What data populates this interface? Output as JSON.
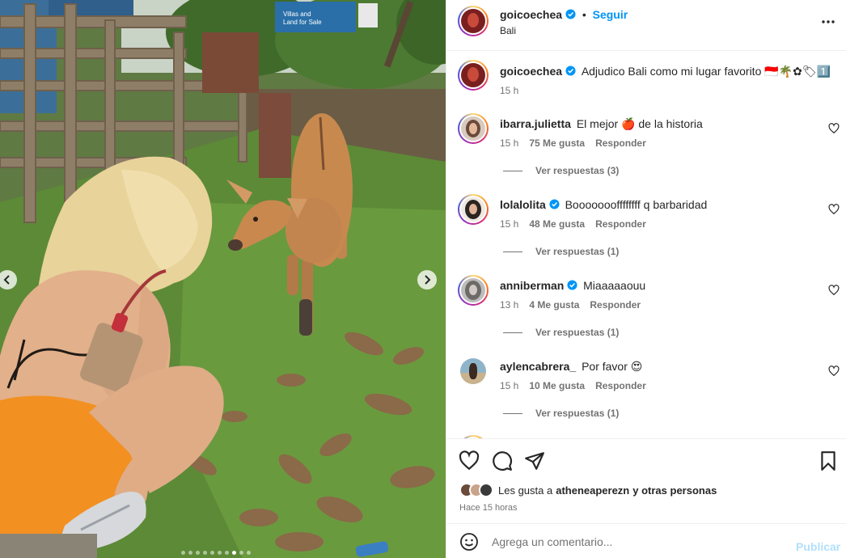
{
  "post": {
    "author": "goicoechea",
    "follow_label": "Seguir",
    "separator": "•",
    "location": "Bali",
    "caption": "Adjudico Bali como mi lugar favorito 🇮🇩🌴✿🏷1️⃣",
    "caption_time": "15 h"
  },
  "comments": [
    {
      "user": "ibarra.julietta",
      "verified": false,
      "text": "El mejor 🍎 de la historia",
      "time": "15 h",
      "likes": "75 Me gusta",
      "reply": "Responder",
      "view_replies": "Ver respuestas (3)"
    },
    {
      "user": "lolalolita",
      "verified": true,
      "text": "Boooooooffffffff q barbaridad",
      "time": "15 h",
      "likes": "48 Me gusta",
      "reply": "Responder",
      "view_replies": "Ver respuestas (1)"
    },
    {
      "user": "anniberman",
      "verified": true,
      "text": "Miaaaaaouu",
      "time": "13 h",
      "likes": "4 Me gusta",
      "reply": "Responder",
      "view_replies": "Ver respuestas (1)"
    },
    {
      "user": "aylencabrera_",
      "verified": false,
      "text": "Por favor 😍",
      "time": "15 h",
      "likes": "10 Me gusta",
      "reply": "Responder",
      "view_replies": "Ver respuestas (1)"
    }
  ],
  "likes": {
    "prefix": "Les gusta a",
    "user": "atheneaperezn",
    "suffix": "y otras personas"
  },
  "post_date": "Hace 15 horas",
  "add_comment": {
    "placeholder": "Agrega un comentario...",
    "publish_label": "Publicar"
  },
  "carousel": {
    "slide_count": 10,
    "active_slide": 8
  },
  "photo_text": {
    "sign_line1": "Villas and",
    "sign_line2": "Land for Sale"
  },
  "colors": {
    "accent": "#0095f6",
    "verified": "#0095f6",
    "publish_disabled": "#b2dffc",
    "muted_text": "#737373"
  },
  "icons": [
    "more-icon",
    "heart-icon",
    "comment-icon",
    "share-icon",
    "bookmark-icon",
    "smile-icon",
    "chevron-left-icon",
    "chevron-right-icon",
    "verified-icon"
  ]
}
